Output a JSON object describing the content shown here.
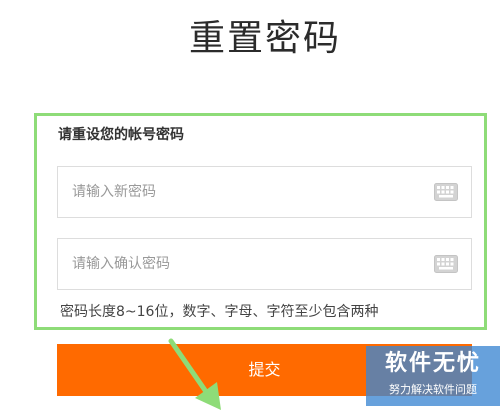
{
  "page": {
    "title": "重置密码"
  },
  "form": {
    "heading": "请重设您的帐号密码",
    "new_password": {
      "placeholder": "请输入新密码",
      "value": "",
      "icon": "keyboard-icon"
    },
    "confirm_password": {
      "placeholder": "请输入确认密码",
      "value": "",
      "icon": "keyboard-icon"
    },
    "hint": "密码长度8~16位，数字、字母、字符至少包含两种",
    "submit_label": "提交"
  },
  "watermark": {
    "title": "软件无忧",
    "subtitle": "努力解决软件问题"
  },
  "colors": {
    "accent": "#ff6a00",
    "highlight": "#8edc78",
    "watermark_bg": "#3c87d2"
  }
}
